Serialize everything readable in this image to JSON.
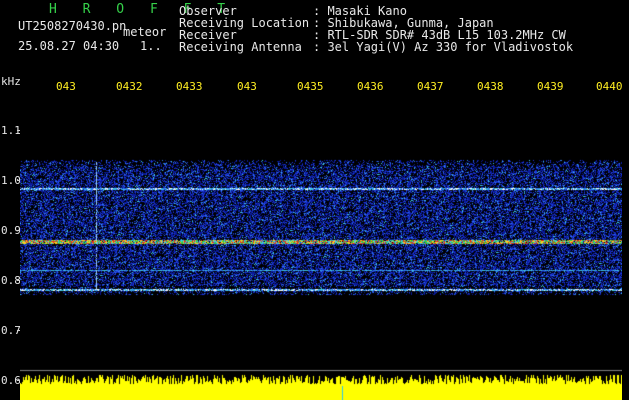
{
  "program": {
    "title": "H R O F F T"
  },
  "file": {
    "name": "UT2508270430.pn",
    "type": "meteor",
    "datetime": "25.08.27 04:30",
    "extra": "1.."
  },
  "info": [
    {
      "label": "Observer",
      "value": ": Masaki Kano"
    },
    {
      "label": "Receiving Location",
      "value": ": Shibukawa, Gunma, Japan"
    },
    {
      "label": "Receiver",
      "value": ": RTL-SDR SDR# 43dB L15 103.2MHz CW"
    },
    {
      "label": "Receiving Antenna",
      "value": ": 3el Yagi(V) Az 330 for Vladivostok"
    }
  ],
  "axis": {
    "unit": "kHz",
    "y_ticks": [
      "1.1",
      "1.0",
      "0.9",
      "0.8",
      "0.7",
      "0.6"
    ],
    "time_ticks": [
      "043",
      "0432",
      "0433",
      "043",
      "0435",
      "0436",
      "0437",
      "0438",
      "0439",
      "0440"
    ]
  },
  "colors": {
    "background": "#000000",
    "noise": "#1a2ad8",
    "signal": "#e03020",
    "time_label": "#ffee22",
    "title": "#35d14a"
  }
}
